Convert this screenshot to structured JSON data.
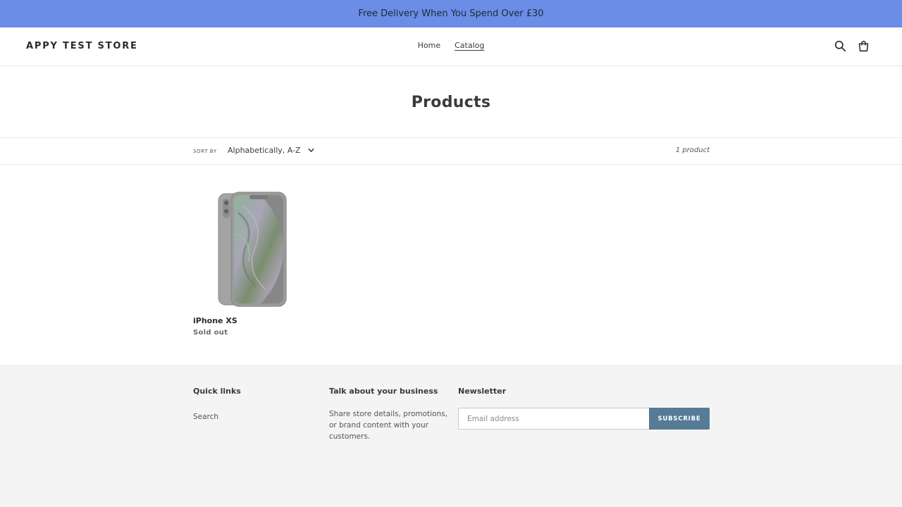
{
  "announcement": {
    "text": "Free Delivery When You Spend Over £30"
  },
  "header": {
    "logo": "APPY TEST STORE",
    "nav": [
      {
        "label": "Home",
        "active": false
      },
      {
        "label": "Catalog",
        "active": true
      }
    ],
    "icons": [
      "search-icon",
      "cart-icon"
    ]
  },
  "page": {
    "title": "Products"
  },
  "filters": {
    "sort_label": "Sort by",
    "sort_value": "Alphabetically, A-Z",
    "product_count": "1 product"
  },
  "products": [
    {
      "title": "iPhone XS",
      "status": "Sold out"
    }
  ],
  "footer": {
    "quick_links": {
      "heading": "Quick links",
      "items": [
        "Search"
      ]
    },
    "business": {
      "heading": "Talk about your business",
      "text": "Share store details, promotions, or brand content with your customers."
    },
    "newsletter": {
      "heading": "Newsletter",
      "email_placeholder": "Email address",
      "subscribe_label": "Subscribe"
    }
  },
  "colors": {
    "announcement_bg": "#6a8de6",
    "accent_button": "#557b97",
    "footer_bg": "#f4f4f4"
  }
}
